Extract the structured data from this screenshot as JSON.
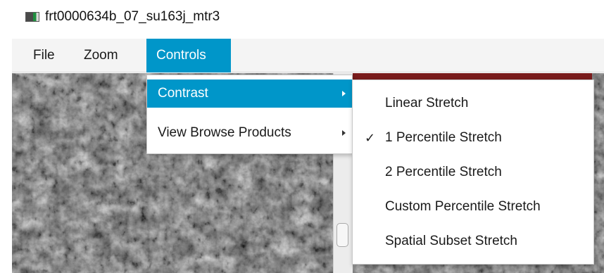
{
  "window": {
    "title": "frt0000634b_07_su163j_mtr3",
    "icon": "image-window-icon"
  },
  "menubar": {
    "items": [
      {
        "label": "File"
      },
      {
        "label": "Zoom"
      },
      {
        "label": "Controls",
        "active": true
      }
    ]
  },
  "controls_menu": {
    "items": [
      {
        "label": "Contrast",
        "has_submenu": true,
        "highlighted": true
      },
      {
        "label": "View Browse Products",
        "has_submenu": true,
        "highlighted": false
      }
    ]
  },
  "contrast_submenu": {
    "items": [
      {
        "label": "Linear Stretch",
        "checked": false
      },
      {
        "label": "1 Percentile Stretch",
        "checked": true,
        "check_mark": "✓"
      },
      {
        "label": "2 Percentile Stretch",
        "checked": false
      },
      {
        "label": "Custom Percentile Stretch",
        "checked": false
      },
      {
        "label": "Spatial Subset Stretch",
        "checked": false
      }
    ]
  },
  "colors": {
    "accent": "#0096c9",
    "menubar_bg": "#f4f4f4",
    "image_border": "#7a1c1c"
  }
}
